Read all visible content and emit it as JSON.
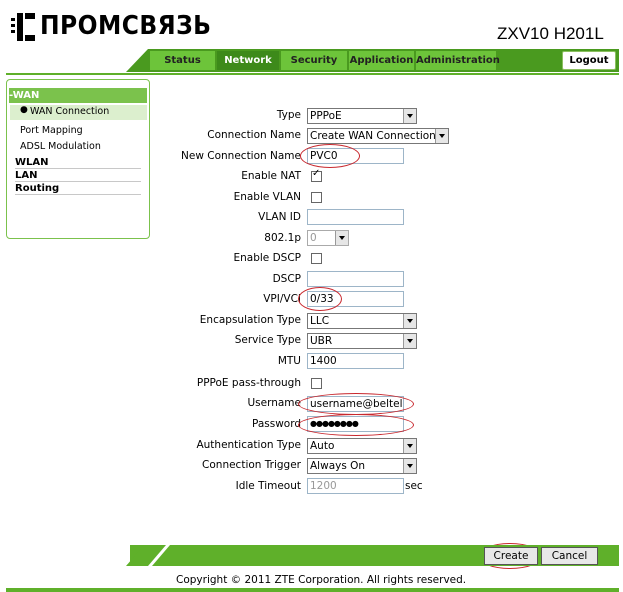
{
  "brand": {
    "name": "ПРОМСВЯЗЬ",
    "model": "ZXV10 H201L"
  },
  "nav": {
    "tabs": [
      "Status",
      "Network",
      "Security",
      "Application",
      "Administration"
    ],
    "active": "Network",
    "logout": "Logout"
  },
  "sidebar": {
    "section": "-WAN",
    "items": [
      "WAN Connection",
      "Port Mapping",
      "ADSL Modulation"
    ],
    "groups": [
      "WLAN",
      "LAN",
      "Routing"
    ]
  },
  "form": {
    "type": {
      "label": "Type",
      "value": "PPPoE"
    },
    "connection_name": {
      "label": "Connection Name",
      "value": "Create WAN Connection"
    },
    "new_connection_name": {
      "label": "New Connection Name",
      "value": "PVC0"
    },
    "enable_nat": {
      "label": "Enable NAT",
      "checked": true
    },
    "enable_vlan": {
      "label": "Enable VLAN",
      "checked": false
    },
    "vlan_id": {
      "label": "VLAN ID",
      "value": ""
    },
    "p8021p": {
      "label": "802.1p",
      "value": "0"
    },
    "enable_dscp": {
      "label": "Enable DSCP",
      "checked": false
    },
    "dscp": {
      "label": "DSCP",
      "value": ""
    },
    "vpi_vci": {
      "label": "VPI/VCI",
      "value": "0/33"
    },
    "encapsulation": {
      "label": "Encapsulation Type",
      "value": "LLC"
    },
    "service_type": {
      "label": "Service Type",
      "value": "UBR"
    },
    "mtu": {
      "label": "MTU",
      "value": "1400"
    },
    "pppoe_passthrough": {
      "label": "PPPoE pass-through",
      "checked": false
    },
    "username": {
      "label": "Username",
      "value": "username@beltel.b"
    },
    "password": {
      "label": "Password",
      "value": "●●●●●●●●"
    },
    "auth_type": {
      "label": "Authentication Type",
      "value": "Auto"
    },
    "conn_trigger": {
      "label": "Connection Trigger",
      "value": "Always On"
    },
    "idle_timeout": {
      "label": "Idle Timeout",
      "value": "1200",
      "unit": "sec"
    }
  },
  "buttons": {
    "create": "Create",
    "cancel": "Cancel"
  },
  "footer": {
    "copyright": "Copyright © 2011 ZTE Corporation. All rights reserved."
  },
  "colors": {
    "accent": "#5fb02a",
    "tab": "#6dc43a",
    "tab_active": "#3d8a1a",
    "highlight_ring": "#c8282e"
  }
}
